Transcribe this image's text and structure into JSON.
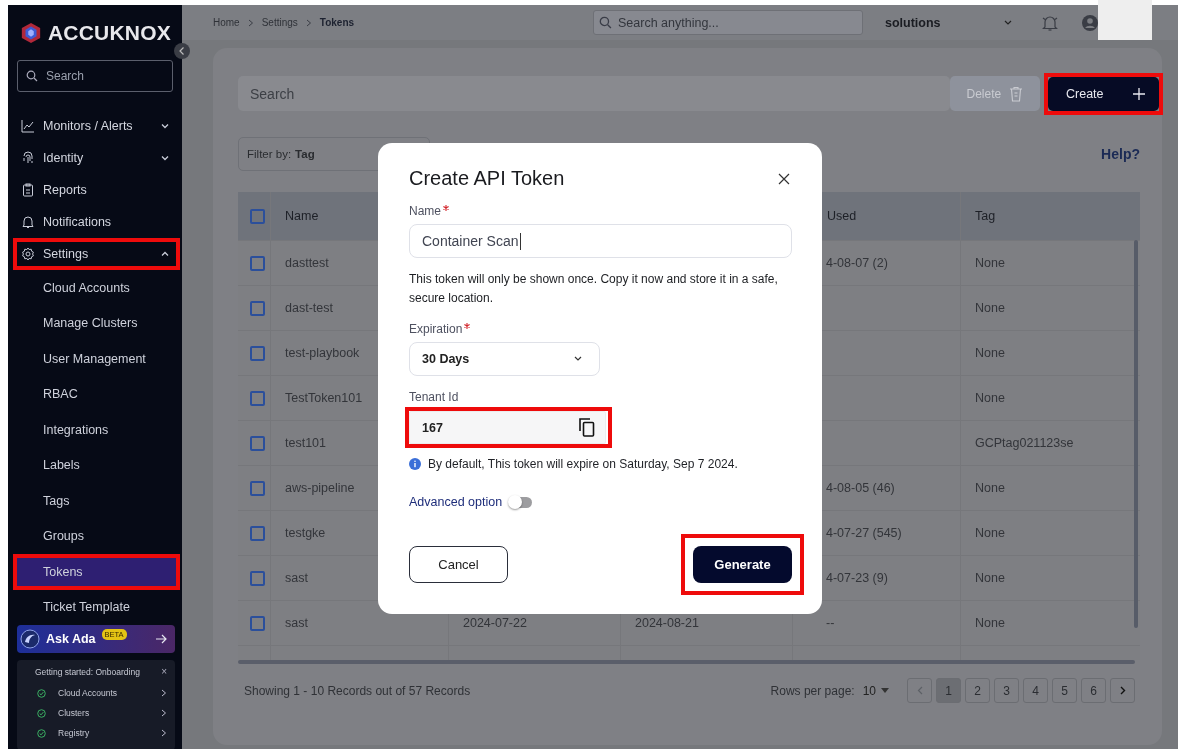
{
  "logo": {
    "text": "ACCUKNOX"
  },
  "sidebar": {
    "search": {
      "placeholder": "Search"
    },
    "items": [
      {
        "label": "Monitors / Alerts",
        "expanded": false,
        "highlighted": false
      },
      {
        "label": "Identity",
        "expanded": false,
        "highlighted": false
      },
      {
        "label": "Reports",
        "highlighted": false
      },
      {
        "label": "Notifications",
        "highlighted": false
      },
      {
        "label": "Settings",
        "expanded": true,
        "highlighted": true,
        "children": [
          {
            "label": "Cloud Accounts",
            "selected": false,
            "highlighted": false
          },
          {
            "label": "Manage Clusters",
            "selected": false,
            "highlighted": false
          },
          {
            "label": "User Management",
            "selected": false,
            "highlighted": false
          },
          {
            "label": "RBAC",
            "selected": false,
            "highlighted": false
          },
          {
            "label": "Integrations",
            "selected": false,
            "highlighted": false
          },
          {
            "label": "Labels",
            "selected": false,
            "highlighted": false
          },
          {
            "label": "Tags",
            "selected": false,
            "highlighted": false
          },
          {
            "label": "Groups",
            "selected": false,
            "highlighted": false
          },
          {
            "label": "Tokens",
            "selected": true,
            "highlighted": true
          },
          {
            "label": "Ticket Template",
            "selected": false,
            "highlighted": false
          }
        ]
      }
    ],
    "ask_ada": {
      "label": "Ask Ada",
      "badge": "BETA"
    },
    "onboarding": {
      "title": "Getting started: Onboarding",
      "close": "×",
      "steps": [
        {
          "label": "Cloud Accounts",
          "done": true
        },
        {
          "label": "Clusters",
          "done": true
        },
        {
          "label": "Registry",
          "done": true
        }
      ]
    }
  },
  "topbar": {
    "breadcrumb": [
      {
        "label": "Home",
        "current": false
      },
      {
        "label": "Settings",
        "current": false
      },
      {
        "label": "Tokens",
        "current": true
      }
    ],
    "search": {
      "placeholder": "Search anything..."
    },
    "organization": "solutions"
  },
  "toolbar": {
    "search": {
      "placeholder": "Search"
    },
    "delete_button": {
      "label": "Delete",
      "disabled": true
    },
    "create_button": {
      "label": "Create",
      "highlighted": true
    }
  },
  "filter": {
    "label": "Filter by:",
    "value": "Tag"
  },
  "help_link": "Help?",
  "table": {
    "select_all_checked": false,
    "columns": [
      {
        "label": "Name"
      },
      {
        "label": "Used"
      },
      {
        "label": "Tag"
      }
    ],
    "rows": [
      {
        "checked": false,
        "name": "dasttest",
        "used": "4-08-07 (2)",
        "tag": "None"
      },
      {
        "checked": false,
        "name": "dast-test",
        "tag": "None"
      },
      {
        "checked": false,
        "name": "test-playbook",
        "tag": "None"
      },
      {
        "checked": false,
        "name": "TestToken101",
        "tag": "None"
      },
      {
        "checked": false,
        "name": "test101",
        "tag": "GCPtag021123se"
      },
      {
        "checked": false,
        "name": "aws-pipeline",
        "used": "4-08-05 (46)",
        "tag": "None"
      },
      {
        "checked": false,
        "name": "testgke",
        "used": "4-07-27 (545)",
        "tag": "None"
      },
      {
        "checked": false,
        "name": "sast",
        "used": "4-07-23 (9)",
        "tag": "None"
      },
      {
        "checked": false,
        "name": "sast",
        "column_3": "2024-07-22",
        "column_4": "2024-08-21",
        "used": "--",
        "tag": "None"
      }
    ]
  },
  "footer": {
    "summary": "Showing 1 - 10 Records out of 57 Records",
    "rows_per_page_label": "Rows per page:",
    "rows_per_page": "10",
    "pages": [
      {
        "label": "1",
        "selected": true
      },
      {
        "label": "2",
        "selected": false
      },
      {
        "label": "3",
        "selected": false
      },
      {
        "label": "4",
        "selected": false
      },
      {
        "label": "5",
        "selected": false
      },
      {
        "label": "6",
        "selected": false
      }
    ]
  },
  "modal": {
    "title": "Create API Token",
    "name_field": {
      "label": "Name",
      "required": true,
      "value": "Container Scan"
    },
    "note": "This token will only be shown once. Copy it now and store it in a safe, secure location.",
    "expiration_field": {
      "label": "Expiration",
      "required": true,
      "value": "30 Days"
    },
    "tenant_field": {
      "label": "Tenant Id",
      "value": "167",
      "highlighted": true
    },
    "info": "By default, This token will expire on Saturday, Sep 7 2024.",
    "advanced_option": {
      "label": "Advanced option",
      "on": false
    },
    "cancel_button": {
      "label": "Cancel"
    },
    "generate_button": {
      "label": "Generate",
      "highlighted": true
    }
  }
}
